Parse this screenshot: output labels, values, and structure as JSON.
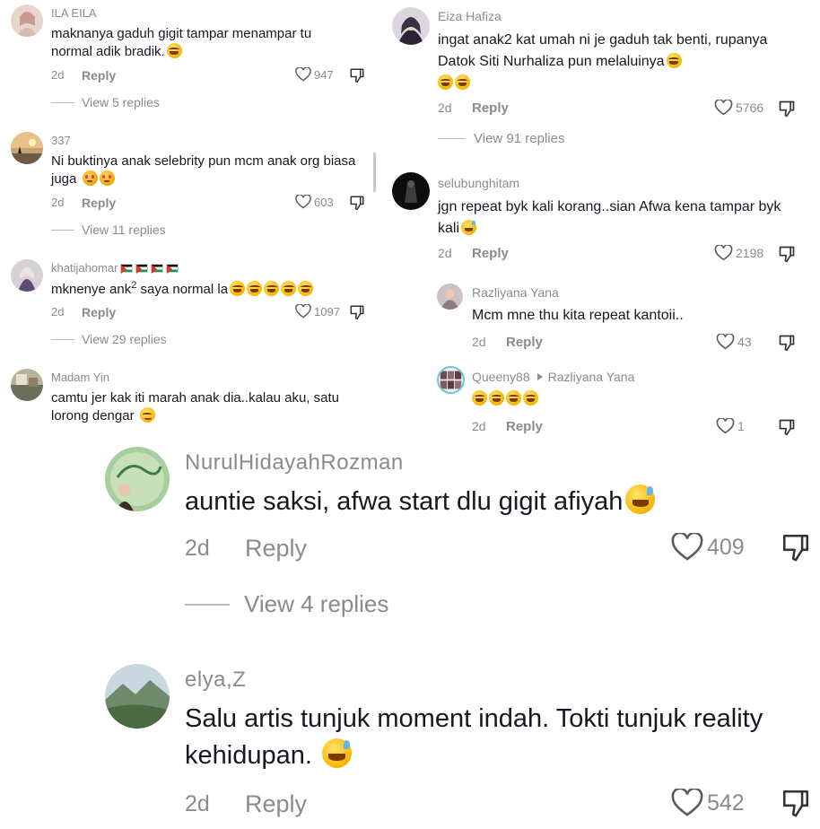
{
  "left_panel": {
    "comments": [
      {
        "username": "ILA EILA",
        "text": "maknanya gaduh gigit tampar menampar tu normal adik bradik.",
        "emojis": [
          "joy"
        ],
        "date": "2d",
        "reply": "Reply",
        "likes": "947",
        "view_replies": "View 5 replies"
      },
      {
        "username": "337",
        "text": "Ni buktinya anak selebrity pun mcm anak org biasa juga",
        "emojis": [
          "smiling-hearts",
          "smiling-hearts"
        ],
        "date": "2d",
        "reply": "Reply",
        "likes": "603",
        "view_replies": "View 11 replies"
      },
      {
        "username": "khatijahomar",
        "text_before": "mknenye ank",
        "superscript": "2",
        "text_after": " saya normal la",
        "emojis": [
          "joy",
          "joy",
          "joy",
          "joy",
          "joy"
        ],
        "date": "2d",
        "reply": "Reply",
        "likes": "1097",
        "view_replies": "View 29 replies"
      },
      {
        "username": "Madam Yin",
        "text": "camtu jer kak iti marah anak dia..kalau aku, satu lorong dengar",
        "emojis": [
          "woozy"
        ]
      }
    ]
  },
  "right_panel": {
    "comments": [
      {
        "username": "Eiza Hafiza",
        "text": "ingat anak2 kat umah ni je gaduh tak benti, rupanya Datok Siti Nurhaliza pun melaluinya",
        "emojis": [
          "joy",
          "joy",
          "joy"
        ],
        "date": "2d",
        "reply": "Reply",
        "likes": "5766",
        "view_replies": "View 91 replies"
      },
      {
        "username": "selubunghitam",
        "text": "jgn repeat byk kali korang..sian Afwa kena tampar byk kali",
        "emojis": [
          "sweat-smile"
        ],
        "date": "2d",
        "reply": "Reply",
        "likes": "2198"
      },
      {
        "username": "Razliyana Yana",
        "text": "Mcm mne thu kita repeat kantoii..",
        "date": "2d",
        "reply": "Reply",
        "likes": "43"
      },
      {
        "username": "Queeny88",
        "reply_to": "Razliyana Yana",
        "text": "",
        "emojis": [
          "joy",
          "joy",
          "joy",
          "joy"
        ],
        "date": "2d",
        "reply": "Reply",
        "likes": "1"
      }
    ]
  },
  "bottom_panel": {
    "comments": [
      {
        "username": "NurulHidayahRozman",
        "text": "auntie saksi, afwa start dlu gigit afiyah",
        "emojis": [
          "sweat-smile"
        ],
        "date": "2d",
        "reply": "Reply",
        "likes": "409",
        "view_replies": "View 4 replies"
      },
      {
        "username": "elya,Z",
        "text": "Salu artis tunjuk moment indah. Tokti tunjuk reality kehidupan.",
        "emojis": [
          "sweat-smile"
        ],
        "date": "2d",
        "reply": "Reply",
        "likes": "542"
      }
    ]
  },
  "colors": {
    "text": "#161823",
    "meta": "#8a8b91",
    "background": "#ffffff"
  }
}
